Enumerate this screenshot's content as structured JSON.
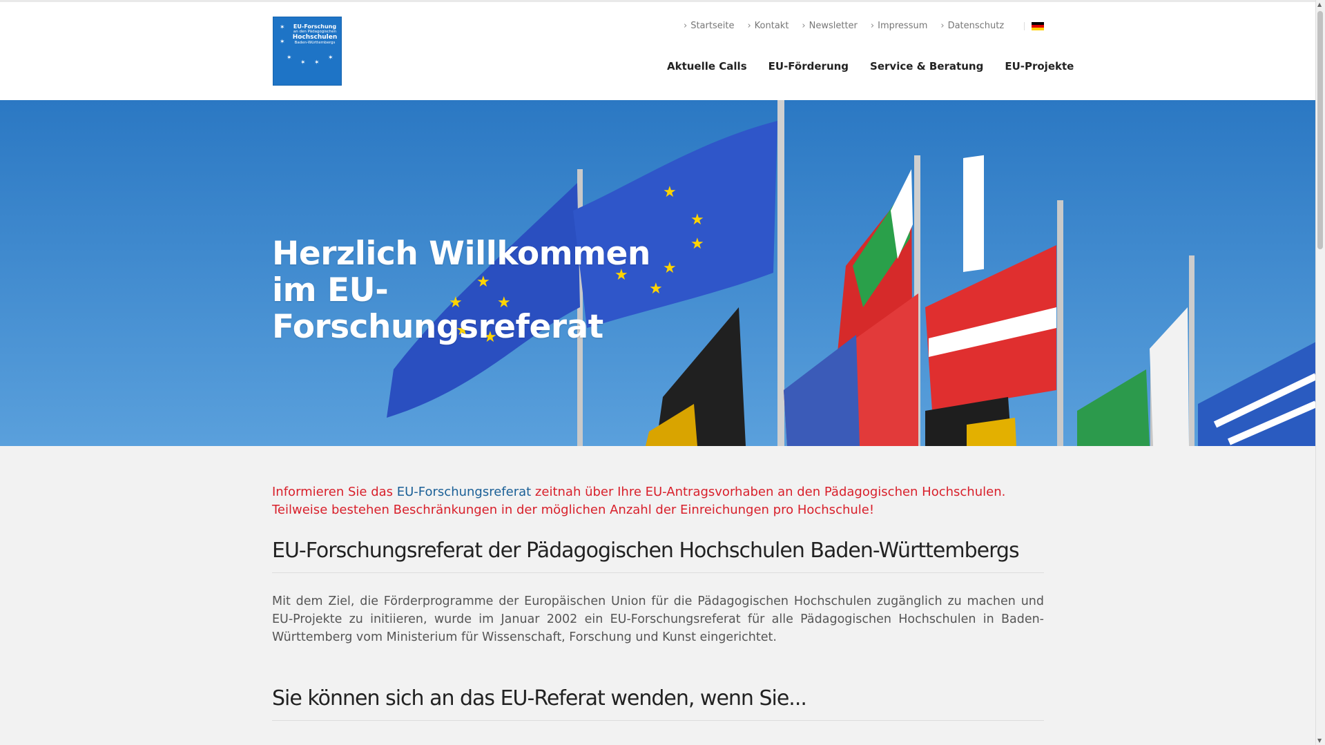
{
  "logo": {
    "line1": "EU-Forschung",
    "line2": "an den Pädagogischen",
    "line3": "Hochschulen",
    "line4": "Baden-Württembergs"
  },
  "top_nav": [
    {
      "label": "Startseite"
    },
    {
      "label": "Kontakt"
    },
    {
      "label": "Newsletter"
    },
    {
      "label": "Impressum"
    },
    {
      "label": "Datenschutz"
    }
  ],
  "language": {
    "icon": "german-flag-icon",
    "colors": [
      "#000000",
      "#dd0000",
      "#ffce00"
    ]
  },
  "main_nav": [
    {
      "label": "Aktuelle Calls"
    },
    {
      "label": "EU-Förderung"
    },
    {
      "label": "Service & Beratung"
    },
    {
      "label": "EU-Projekte"
    }
  ],
  "hero": {
    "line1": "Herzlich Willkommen",
    "line2": "im EU-",
    "line3": "Forschungsreferat"
  },
  "notice": {
    "before": "Informieren Sie das ",
    "link": "EU-Forschungsreferat",
    "after": " zeitnah über Ihre EU-Antragsvorhaben an den Pädagogischen Hochschulen.",
    "line2": "Teilweise bestehen Beschränkungen in der möglichen Anzahl der Einreichungen pro Hochschule!"
  },
  "section1": {
    "heading": "EU-Forschungsreferat der Pädagogischen Hochschulen Baden-Württembergs",
    "body": "Mit dem Ziel, die Förderprogramme der Europäischen Union für die Pädagogischen Hochschulen zugänglich zu machen und EU-Projekte zu initiieren, wurde im Januar 2002 ein EU-Forschungsreferat für alle Pädagogischen Hochschulen in Baden-Württemberg vom Ministerium für Wissenschaft, Forschung und Kunst eingerichtet."
  },
  "section2": {
    "heading": "Sie können sich an das EU-Referat wenden, wenn Sie..."
  },
  "colors": {
    "brand_blue": "#1e74c6",
    "notice_red": "#d81f2a",
    "link_blue": "#1a5f96"
  }
}
